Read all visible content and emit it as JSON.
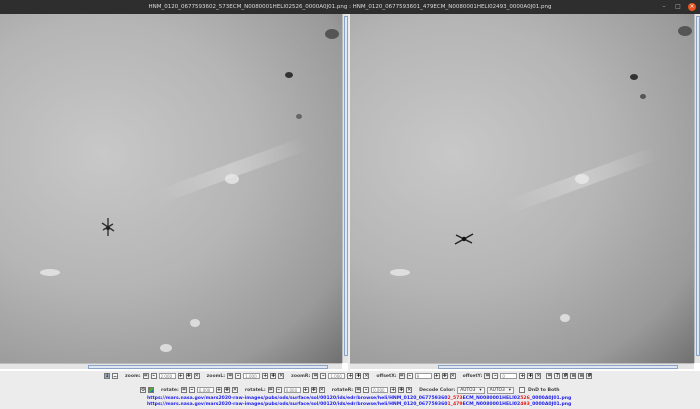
{
  "window": {
    "title": "HNM_0120_0677593602_573ECM_N0080001HELI02526_0000A0J01.png : HNM_0120_0677593601_479ECM_N0080001HELI02493_0000A0J01.png"
  },
  "toolbar1": {
    "zoom_label": "zoom:",
    "zoom": "2.000",
    "zoomL_label": "zoomL:",
    "zoomL": "1.000",
    "zoomR_label": "zoomR:",
    "zoomR": "1.000",
    "offsetX_label": "offsetX:",
    "offsetX": "9",
    "offsetY_label": "offsetY:",
    "offsetY": "0"
  },
  "toolbar2": {
    "rotate_label": "rotate:",
    "rotate": "0.000",
    "rotateL_label": "rotateL:",
    "rotateL": "0.000",
    "rotateR_label": "rotateR:",
    "rotateR": "0.000",
    "decode_label": "Decode Color:",
    "decodeL": "AUTO3",
    "decodeR": "AUTO3",
    "dnd_label": "DnD to Both"
  },
  "urls": [
    {
      "pre": "https://mars.nasa.gov/mars2020-raw-images/pubs/ods/surface/sol/00120/ids/edr/browse/heli/HNM_0120_067759360",
      "r1": "2_573",
      "mid": "ECM_N0080001HELI02",
      "r2": "526",
      "post": "_0000A0J01.png"
    },
    {
      "pre": "https://mars.nasa.gov/mars2020-raw-images/pubs/ods/surface/sol/00120/ids/edr/browse/heli/HNM_0120_067759360",
      "r1": "1_479",
      "mid": "ECM_N0080001HELI02",
      "r2": "493",
      "post": "_0000A0J01.png"
    }
  ]
}
